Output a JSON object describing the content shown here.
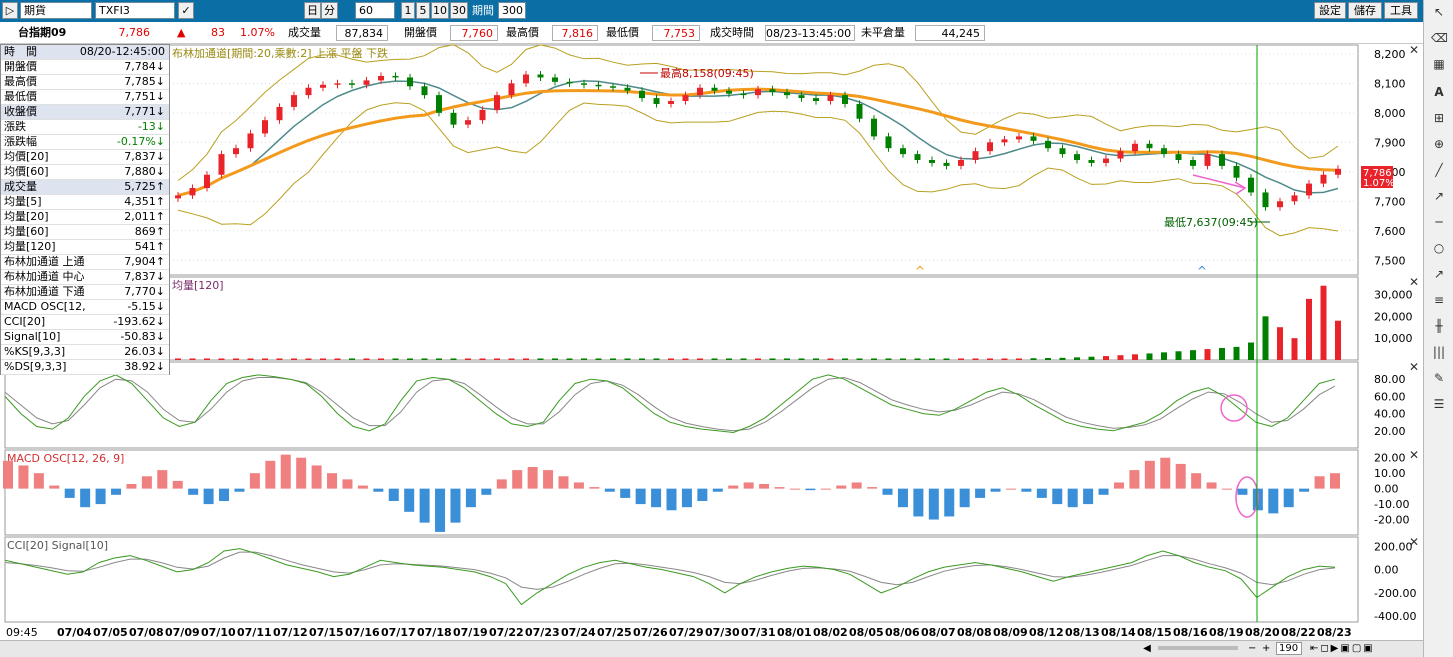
{
  "toolbar": {
    "market": "期貨",
    "symbol": "TXFI3",
    "period_day": "日",
    "period_min": "分",
    "interval": "60",
    "quick": [
      "1",
      "5",
      "10",
      "30"
    ],
    "period_label": "期間",
    "period_value": "300",
    "settings": "設定",
    "save": "儲存",
    "tools": "工具"
  },
  "quote": {
    "name": "台指期09",
    "price": "7,786",
    "change": "83",
    "change_pct": "1.07%",
    "volume_label": "成交量",
    "volume": "87,834",
    "open_label": "開盤價",
    "open": "7,760",
    "high_label": "最高價",
    "high": "7,816",
    "low_label": "最低價",
    "low": "7,753",
    "time_label": "成交時間",
    "time": "08/23-13:45:00",
    "oi_label": "未平倉量",
    "oi": "44,245"
  },
  "info_panel": {
    "rows": [
      {
        "label": "時　間",
        "value": "08/20-12:45:00",
        "color": "blk",
        "hl": true
      },
      {
        "label": "開盤價",
        "value": "7,784↓",
        "color": "blk"
      },
      {
        "label": "最高價",
        "value": "7,785↓",
        "color": "blk"
      },
      {
        "label": "最低價",
        "value": "7,751↓",
        "color": "blk"
      },
      {
        "label": "收盤價",
        "value": "7,771↓",
        "color": "blk",
        "hl": true
      },
      {
        "label": "漲跌",
        "value": "-13↓",
        "color": "grn"
      },
      {
        "label": "漲跌幅",
        "value": "-0.17%↓",
        "color": "grn"
      },
      {
        "label": "均價[20]",
        "value": "7,837↓",
        "color": "blk"
      },
      {
        "label": "均價[60]",
        "value": "7,880↓",
        "color": "blk"
      },
      {
        "label": "成交量",
        "value": "5,725↑",
        "color": "blk",
        "hl": true
      },
      {
        "label": "均量[5]",
        "value": "4,351↑",
        "color": "blk"
      },
      {
        "label": "均量[20]",
        "value": "2,011↑",
        "color": "blk"
      },
      {
        "label": "均量[60]",
        "value": "869↑",
        "color": "blk"
      },
      {
        "label": "均量[120]",
        "value": "541↑",
        "color": "blk"
      },
      {
        "label": "布林加通道 上通",
        "value": "7,904↑",
        "color": "blk"
      },
      {
        "label": "布林加通道 中心",
        "value": "7,837↓",
        "color": "blk"
      },
      {
        "label": "布林加通道 下通",
        "value": "7,770↓",
        "color": "blk"
      },
      {
        "label": "MACD OSC[12, 26",
        "value": "-5.15↓",
        "color": "blk"
      },
      {
        "label": "CCI[20]",
        "value": "-193.62↓",
        "color": "blk"
      },
      {
        "label": "Signal[10]",
        "value": "-50.83↓",
        "color": "blk"
      },
      {
        "label": "%KS[9,3,3]",
        "value": "26.03↓",
        "color": "blk"
      },
      {
        "label": "%DS[9,3,3]",
        "value": "38.92↓",
        "color": "blk"
      }
    ]
  },
  "colors": {
    "up": "#e8232a",
    "down": "#008000",
    "ma20": "#4f8a8b",
    "ma60": "#f39a1d",
    "band": "#b8a020",
    "macd_pos": "#f08080",
    "macd_neg": "#3a8fd8",
    "k_line": "#3a9a20",
    "d_line": "#888888",
    "crosshair": "#00a000"
  },
  "chart_data": [
    {
      "type": "candlestick",
      "name": "price",
      "legend": "布林加通道[期間:20,乘數:2] 上漲  平盤  下跌",
      "y_ticks": [
        "8,200",
        "8,100",
        "8,000",
        "7,900",
        "7,800",
        "7,700",
        "7,600",
        "7,500"
      ],
      "ylim": [
        7450,
        8230
      ],
      "annotation_high": "最高8,158(09:45)",
      "annotation_low": "最低7,637(09:45)",
      "last_price_label": "7,786",
      "last_pct_label": "1.07%",
      "close": [
        7720,
        7745,
        7790,
        7860,
        7880,
        7930,
        7975,
        8020,
        8060,
        8085,
        8095,
        8100,
        8095,
        8110,
        8125,
        8120,
        8090,
        8060,
        8000,
        7960,
        7975,
        8010,
        8060,
        8100,
        8130,
        8120,
        8105,
        8100,
        8095,
        8090,
        8085,
        8075,
        8050,
        8030,
        8040,
        8060,
        8085,
        8075,
        8065,
        8060,
        8080,
        8070,
        8060,
        8050,
        8040,
        8060,
        8030,
        7980,
        7920,
        7880,
        7860,
        7840,
        7830,
        7820,
        7840,
        7870,
        7900,
        7910,
        7920,
        7905,
        7880,
        7860,
        7840,
        7830,
        7845,
        7870,
        7895,
        7880,
        7860,
        7840,
        7820,
        7860,
        7820,
        7780,
        7730,
        7680,
        7700,
        7720,
        7760,
        7790,
        7810
      ]
    },
    {
      "type": "bar",
      "name": "volume",
      "legend": "均量[120]",
      "y_ticks": [
        "30,000",
        "20,000",
        "10,000"
      ],
      "ylim": [
        0,
        38000
      ],
      "values": [
        700,
        700,
        700,
        700,
        700,
        700,
        700,
        700,
        700,
        700,
        700,
        700,
        700,
        700,
        700,
        700,
        700,
        700,
        700,
        700,
        700,
        700,
        700,
        700,
        700,
        700,
        700,
        700,
        700,
        700,
        700,
        700,
        700,
        700,
        700,
        700,
        700,
        700,
        700,
        700,
        700,
        700,
        700,
        700,
        700,
        700,
        700,
        700,
        700,
        700,
        700,
        700,
        700,
        700,
        700,
        700,
        700,
        700,
        700,
        800,
        900,
        1000,
        1200,
        1500,
        1800,
        2200,
        2600,
        3000,
        3500,
        4000,
        4500,
        5000,
        5500,
        6000,
        8000,
        20000,
        15000,
        10000,
        28000,
        34000,
        18000
      ]
    },
    {
      "type": "line",
      "name": "kd",
      "y_ticks": [
        "80.00",
        "60.00",
        "40.00",
        "20.00"
      ],
      "ylim": [
        0,
        100
      ],
      "k": [
        60,
        40,
        25,
        22,
        35,
        60,
        78,
        85,
        75,
        55,
        35,
        25,
        30,
        55,
        75,
        82,
        85,
        83,
        80,
        75,
        60,
        40,
        25,
        20,
        28,
        55,
        78,
        82,
        80,
        70,
        55,
        40,
        28,
        25,
        30,
        55,
        75,
        80,
        78,
        70,
        55,
        40,
        30,
        25,
        22,
        20,
        18,
        25,
        35,
        50,
        65,
        80,
        85,
        80,
        70,
        60,
        50,
        45,
        40,
        38,
        45,
        55,
        65,
        70,
        62,
        50,
        40,
        30,
        25,
        22,
        20,
        25,
        30,
        40,
        55,
        65,
        70,
        60,
        45,
        30,
        25,
        35,
        55,
        75,
        80
      ],
      "d": [
        65,
        50,
        35,
        28,
        32,
        50,
        70,
        80,
        78,
        65,
        45,
        32,
        30,
        45,
        65,
        78,
        82,
        82,
        80,
        76,
        65,
        50,
        35,
        26,
        26,
        42,
        65,
        78,
        80,
        75,
        62,
        48,
        35,
        28,
        28,
        42,
        62,
        75,
        78,
        73,
        62,
        48,
        36,
        29,
        25,
        22,
        20,
        22,
        30,
        42,
        56,
        70,
        80,
        82,
        76,
        66,
        56,
        50,
        45,
        42,
        44,
        50,
        58,
        65,
        63,
        56,
        46,
        36,
        30,
        26,
        23,
        24,
        27,
        34,
        46,
        57,
        65,
        63,
        53,
        40,
        30,
        32,
        45,
        62,
        72
      ]
    },
    {
      "type": "bar",
      "name": "macd",
      "legend": "MACD OSC[12, 26, 9]",
      "y_ticks": [
        "20.00",
        "10.00",
        "0.00",
        "-10.00",
        "-20.00"
      ],
      "ylim": [
        -30,
        25
      ],
      "values": [
        18,
        15,
        10,
        2,
        -6,
        -12,
        -10,
        -4,
        3,
        8,
        12,
        5,
        -4,
        -10,
        -8,
        -2,
        10,
        18,
        22,
        20,
        15,
        10,
        6,
        2,
        -2,
        -8,
        -15,
        -22,
        -28,
        -22,
        -12,
        -4,
        6,
        12,
        14,
        12,
        8,
        4,
        1,
        -2,
        -6,
        -10,
        -12,
        -14,
        -12,
        -8,
        -2,
        2,
        4,
        3,
        1,
        0,
        -1,
        0,
        2,
        4,
        1,
        -4,
        -12,
        -18,
        -20,
        -18,
        -12,
        -6,
        -2,
        0,
        -2,
        -6,
        -10,
        -12,
        -10,
        -4,
        4,
        12,
        18,
        20,
        16,
        10,
        4,
        0,
        -4,
        -14,
        -16,
        -12,
        -2,
        8,
        10
      ]
    },
    {
      "type": "line",
      "name": "cci",
      "legend": "CCI[20]  Signal[10]",
      "y_ticks": [
        "200.00",
        "0.00",
        "-200.00",
        "-400.00"
      ],
      "ylim": [
        -450,
        280
      ],
      "cci": [
        80,
        50,
        20,
        -10,
        -40,
        -20,
        60,
        100,
        120,
        80,
        30,
        -20,
        0,
        60,
        160,
        180,
        140,
        90,
        40,
        10,
        -20,
        -60,
        -40,
        20,
        80,
        60,
        40,
        30,
        20,
        0,
        -20,
        -60,
        -120,
        -300,
        -200,
        -120,
        -40,
        20,
        60,
        80,
        50,
        20,
        0,
        -30,
        -60,
        -120,
        -200,
        -120,
        -60,
        -20,
        10,
        30,
        20,
        0,
        -40,
        -120,
        -200,
        -150,
        -80,
        -20,
        20,
        40,
        60,
        40,
        10,
        -20,
        -60,
        -100,
        -60,
        -30,
        0,
        30,
        60,
        120,
        160,
        120,
        60,
        20,
        -10,
        -80,
        -240,
        -150,
        -60,
        0,
        30,
        20
      ],
      "signal": [
        60,
        50,
        35,
        15,
        -10,
        -15,
        20,
        60,
        90,
        90,
        60,
        20,
        5,
        30,
        100,
        150,
        150,
        120,
        80,
        40,
        10,
        -20,
        -30,
        0,
        40,
        50,
        45,
        38,
        30,
        15,
        0,
        -30,
        -70,
        -150,
        -170,
        -150,
        -100,
        -40,
        10,
        50,
        55,
        40,
        20,
        0,
        -25,
        -60,
        -110,
        -120,
        -90,
        -50,
        -15,
        10,
        15,
        5,
        -15,
        -60,
        -110,
        -130,
        -110,
        -60,
        -15,
        15,
        35,
        40,
        25,
        0,
        -30,
        -60,
        -65,
        -50,
        -25,
        5,
        35,
        80,
        120,
        120,
        90,
        50,
        15,
        -30,
        -110,
        -130,
        -95,
        -40,
        0,
        15
      ]
    }
  ],
  "x_axis": {
    "first_label": "09:45",
    "labels": [
      "07/04",
      "07/05",
      "07/08",
      "07/09",
      "07/10",
      "07/11",
      "07/12",
      "07/15",
      "07/16",
      "07/17",
      "07/18",
      "07/19",
      "07/22",
      "07/23",
      "07/24",
      "07/25",
      "07/26",
      "07/29",
      "07/30",
      "07/31",
      "08/01",
      "08/02",
      "08/05",
      "08/06",
      "08/07",
      "08/08",
      "08/09",
      "08/12",
      "08/13",
      "08/14",
      "08/15",
      "08/16",
      "08/19",
      "08/20",
      "08/22",
      "08/23"
    ]
  },
  "bottom": {
    "zoom": "190"
  }
}
